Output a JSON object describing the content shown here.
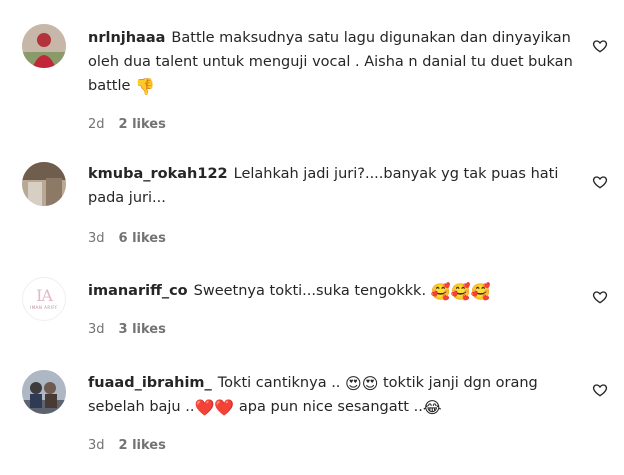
{
  "comments": [
    {
      "username": "nrlnjhaaa",
      "text": "Battle maksudnya satu lagu digunakan dan dinyayikan oleh dua talent untuk menguji vocal . Aisha n danial tu duet bukan battle",
      "emoji": "👎",
      "time": "2d",
      "likes": "2 likes"
    },
    {
      "username": "kmuba_rokah122",
      "text": "Lelahkah jadi juri?....banyak yg tak puas hati pada juri...",
      "time": "3d",
      "likes": "6 likes"
    },
    {
      "username": "imanariff_co",
      "text": "Sweetnya tokti...suka tengokkk.",
      "emoji": "🥰🥰🥰",
      "time": "3d",
      "likes": "3 likes",
      "avatar_logo": {
        "letters": "IA",
        "sub": "IMAN ARIFF"
      }
    },
    {
      "username": "fuaad_ibrahim_",
      "text_a": "Tokti cantiknya ..",
      "emoji_a": "😍😍",
      "text_b": "toktik janji dgn orang sebelah baju ..",
      "emoji_b": "❤️❤️",
      "text_c": "apa pun nice sesangatt ..",
      "emoji_c": "😂",
      "time": "3d",
      "likes": "2 likes"
    }
  ],
  "icons": {
    "like": "heart-outline-icon"
  }
}
